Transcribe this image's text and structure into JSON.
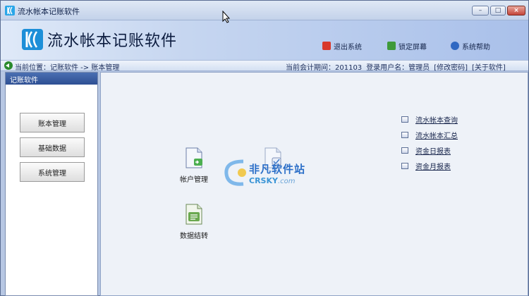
{
  "window": {
    "title": "流水帐本记账软件",
    "controls": {
      "min": "–",
      "max": "□",
      "close": "×"
    }
  },
  "header": {
    "app_title": "流水帐本记账软件",
    "buttons": [
      {
        "label": "退出系统",
        "icon": "exit-icon",
        "color": "#d8382a"
      },
      {
        "label": "锁定屏幕",
        "icon": "lock-icon",
        "color": "#3f9a3a"
      },
      {
        "label": "系统帮助",
        "icon": "help-icon",
        "color": "#2f68c2"
      }
    ]
  },
  "breadcrumb": {
    "path": "当前位置：记账软件 -> 账本管理",
    "period": "当前会计期间：201103",
    "user": "登录用户名：管理员",
    "change_password": "[修改密码]",
    "about": "[关于软件]"
  },
  "sidebar": {
    "title": "记账软件",
    "items": [
      {
        "label": "账本管理"
      },
      {
        "label": "基础数据"
      },
      {
        "label": "系统管理"
      }
    ]
  },
  "main": {
    "modules": [
      {
        "label": "帐户管理",
        "icon": "account-doc-icon"
      },
      {
        "label": "数据结转",
        "icon": "transfer-doc-icon"
      }
    ],
    "reports": [
      {
        "label": "流水帐本查询"
      },
      {
        "label": "流水帐本汇总"
      },
      {
        "label": "资金日报表"
      },
      {
        "label": "资金月报表"
      }
    ]
  },
  "watermark": {
    "cn": "非凡软件站",
    "en": "CRSKY",
    "domain": ".com"
  },
  "colors": {
    "accent": "#2e4f93",
    "banner_start": "#dfe9f8",
    "banner_end": "#a9c0ea",
    "main_bg": "#eef2f8"
  }
}
